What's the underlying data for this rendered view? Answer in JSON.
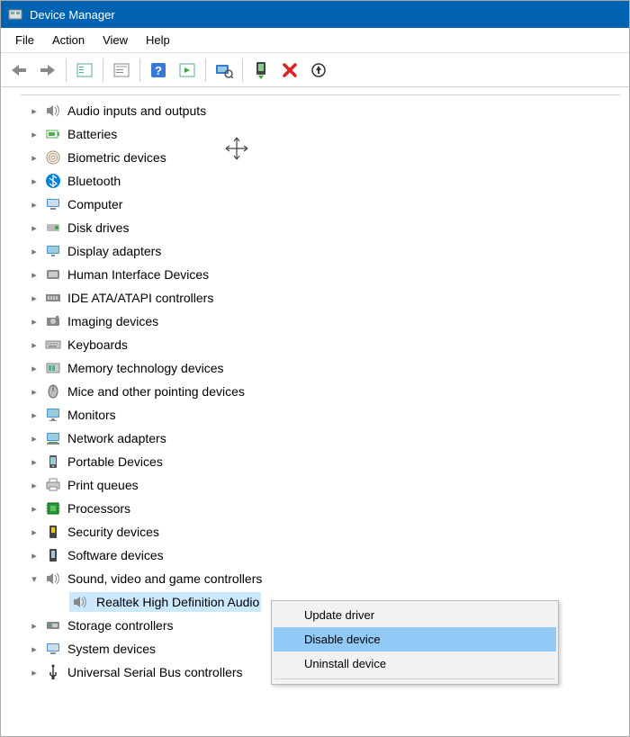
{
  "window": {
    "title": "Device Manager"
  },
  "menubar": [
    "File",
    "Action",
    "View",
    "Help"
  ],
  "tree": [
    {
      "label": "Audio inputs and outputs",
      "icon": "speaker",
      "expanded": false
    },
    {
      "label": "Batteries",
      "icon": "battery",
      "expanded": false
    },
    {
      "label": "Biometric devices",
      "icon": "fingerprint",
      "expanded": false
    },
    {
      "label": "Bluetooth",
      "icon": "bluetooth",
      "expanded": false
    },
    {
      "label": "Computer",
      "icon": "computer",
      "expanded": false
    },
    {
      "label": "Disk drives",
      "icon": "disk",
      "expanded": false
    },
    {
      "label": "Display adapters",
      "icon": "display",
      "expanded": false
    },
    {
      "label": "Human Interface Devices",
      "icon": "hid",
      "expanded": false
    },
    {
      "label": "IDE ATA/ATAPI controllers",
      "icon": "ide",
      "expanded": false
    },
    {
      "label": "Imaging devices",
      "icon": "imaging",
      "expanded": false
    },
    {
      "label": "Keyboards",
      "icon": "keyboard",
      "expanded": false
    },
    {
      "label": "Memory technology devices",
      "icon": "memory",
      "expanded": false
    },
    {
      "label": "Mice and other pointing devices",
      "icon": "mouse",
      "expanded": false
    },
    {
      "label": "Monitors",
      "icon": "monitor",
      "expanded": false
    },
    {
      "label": "Network adapters",
      "icon": "network",
      "expanded": false
    },
    {
      "label": "Portable Devices",
      "icon": "portable",
      "expanded": false
    },
    {
      "label": "Print queues",
      "icon": "printer",
      "expanded": false
    },
    {
      "label": "Processors",
      "icon": "processor",
      "expanded": false
    },
    {
      "label": "Security devices",
      "icon": "security",
      "expanded": false
    },
    {
      "label": "Software devices",
      "icon": "software",
      "expanded": false
    },
    {
      "label": "Sound, video and game controllers",
      "icon": "speaker",
      "expanded": true,
      "children": [
        {
          "label": "Realtek High Definition Audio",
          "icon": "speaker",
          "selected": true
        }
      ]
    },
    {
      "label": "Storage controllers",
      "icon": "storage",
      "expanded": false
    },
    {
      "label": "System devices",
      "icon": "system",
      "expanded": false
    },
    {
      "label": "Universal Serial Bus controllers",
      "icon": "usb",
      "expanded": false
    }
  ],
  "context_menu": {
    "items": [
      {
        "label": "Update driver"
      },
      {
        "label": "Disable device",
        "highlight": true
      },
      {
        "label": "Uninstall device"
      }
    ]
  }
}
